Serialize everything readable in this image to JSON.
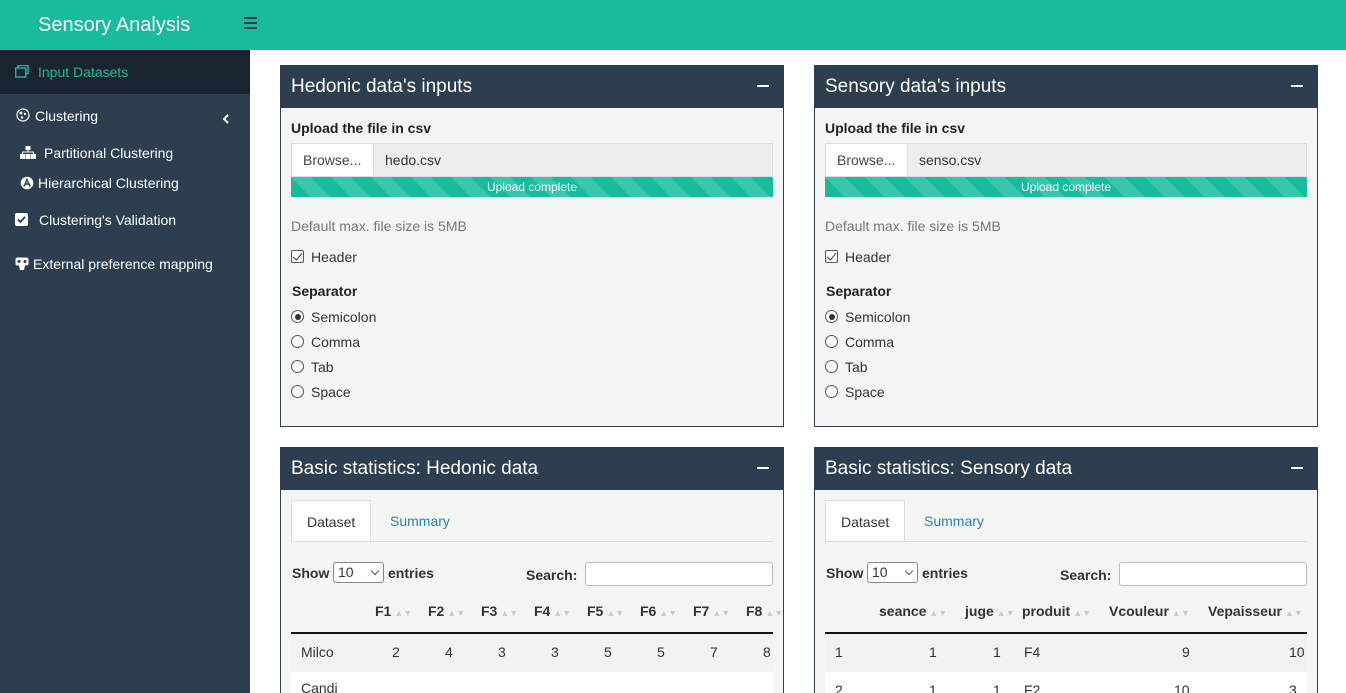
{
  "app": {
    "title": "Sensory Analysis"
  },
  "colors": {
    "brand": "#18bc9c",
    "sidebar": "#2c3e50",
    "link": "#2c7fb8"
  },
  "sidebar": {
    "items": [
      {
        "label": "Input Datasets",
        "icon": "datasets-icon"
      },
      {
        "label": "Clustering",
        "icon": "clustering-icon"
      },
      {
        "label": "Partitional Clustering",
        "icon": "sitemap-icon"
      },
      {
        "label": "Hierarchical Clustering",
        "icon": "hierarchy-icon"
      },
      {
        "label": "Clustering's Validation",
        "icon": "check-square-icon"
      },
      {
        "label": "External preference mapping",
        "icon": "mapping-icon"
      }
    ]
  },
  "hedonic_input": {
    "title": "Hedonic data's inputs",
    "upload_label": "Upload the file in csv",
    "browse_label": "Browse...",
    "filename": "hedo.csv",
    "progress_text": "Upload complete",
    "progress": 1.0,
    "hint": "Default max. file size is 5MB",
    "header_label": "Header",
    "header_checked": true,
    "separator_label": "Separator",
    "separators": [
      "Semicolon",
      "Comma",
      "Tab",
      "Space"
    ],
    "selected_separator": "Semicolon"
  },
  "sensory_input": {
    "title": "Sensory data's inputs",
    "upload_label": "Upload the file in csv",
    "browse_label": "Browse...",
    "filename": "senso.csv",
    "progress_text": "Upload complete",
    "progress": 1.0,
    "hint": "Default max. file size is 5MB",
    "header_label": "Header",
    "header_checked": true,
    "separator_label": "Separator",
    "separators": [
      "Semicolon",
      "Comma",
      "Tab",
      "Space"
    ],
    "selected_separator": "Semicolon"
  },
  "hedonic_stats": {
    "title": "Basic statistics: Hedonic data",
    "tabs": [
      "Dataset",
      "Summary"
    ],
    "show_label": "Show",
    "entries_value": "10",
    "entries_label": "entries",
    "search_label": "Search:",
    "columns": [
      "F1",
      "F2",
      "F3",
      "F4",
      "F5",
      "F6",
      "F7",
      "F8"
    ],
    "rows": [
      {
        "name": "Milco",
        "values": [
          "2",
          "4",
          "3",
          "3",
          "5",
          "5",
          "7",
          "8"
        ]
      },
      {
        "name": "Candi",
        "values": []
      }
    ]
  },
  "sensory_stats": {
    "title": "Basic statistics: Sensory data",
    "tabs": [
      "Dataset",
      "Summary"
    ],
    "show_label": "Show",
    "entries_value": "10",
    "entries_label": "entries",
    "search_label": "Search:",
    "columns": [
      "seance",
      "juge",
      "produit",
      "Vcouleur",
      "Vepaisseur"
    ],
    "rows": [
      {
        "index": "1",
        "values": [
          "1",
          "1",
          "F4",
          "9",
          "10"
        ]
      },
      {
        "index": "2",
        "values": [
          "1",
          "1",
          "F2",
          "10",
          "3"
        ]
      }
    ]
  }
}
